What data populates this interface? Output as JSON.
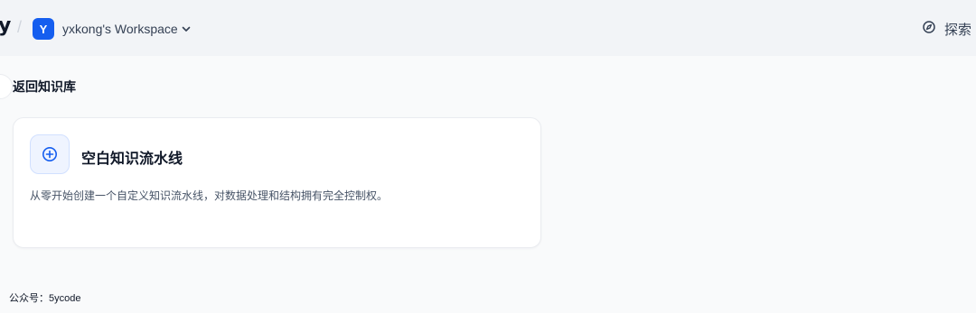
{
  "header": {
    "logo_fragment": "y",
    "separator": "/",
    "workspace": {
      "avatar_letter": "Y",
      "name": "yxkong's Workspace",
      "avatar_color": "#155eef"
    },
    "explore_label": "探索"
  },
  "main": {
    "back_label": "返回知识库",
    "card": {
      "title": "空白知识流水线",
      "description": "从零开始创建一个自定义知识流水线，对数据处理和结构拥有完全控制权。",
      "icon": "plus-circle-icon"
    }
  },
  "footer_note": "公众号：5ycode"
}
